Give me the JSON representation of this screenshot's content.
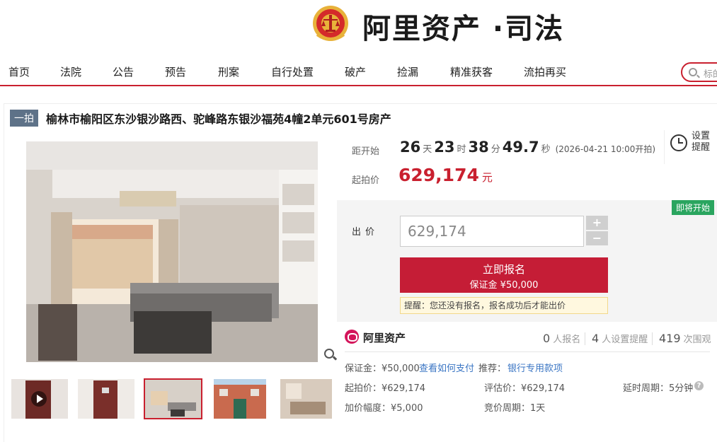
{
  "header": {
    "logo_text": "阿里资产 ·司法"
  },
  "nav": {
    "items": [
      "首页",
      "法院",
      "公告",
      "预告",
      "刑案",
      "自行处置",
      "破产",
      "捡漏",
      "精准获客",
      "流拍再买"
    ],
    "search_placeholder": "标的"
  },
  "auction": {
    "badge": "一拍",
    "title": "榆林市榆阳区东沙银沙路西、驼峰路东银沙福苑4幢2单元601号房产"
  },
  "countdown": {
    "label": "距开始",
    "days": "26",
    "days_unit": "天",
    "hours": "23",
    "hours_unit": "时",
    "minutes": "38",
    "minutes_unit": "分",
    "seconds": "49.7",
    "seconds_unit": "秒",
    "start_time": "(2026-04-21 10:00开拍)"
  },
  "start_price": {
    "label": "起拍价",
    "value": "629,174",
    "unit": "元"
  },
  "reminder": {
    "label": "设置提醒"
  },
  "bid": {
    "status_badge": "即将开始",
    "label": "出价",
    "amount": "629,174",
    "plus": "+",
    "minus": "−",
    "apply_label": "立即报名",
    "deposit_label": "保证金 ¥50,000",
    "tip": "提醒：您还没有报名，报名成功后才能出价"
  },
  "stats": {
    "brand": "阿里资产",
    "signups": "0",
    "signups_label": "人报名",
    "reminders": "4",
    "reminders_label": "人设置提醒",
    "views": "419",
    "views_label": "次围观"
  },
  "details": {
    "deposit": "保证金：¥50,000",
    "how_to_pay": "查看如何支付",
    "recommend": "推荐：",
    "bank_fund": "银行专用款项",
    "start_price": "起拍价：¥629,174",
    "appraisal": "评估价：¥629,174",
    "delay_period": "延时周期：5分钟",
    "increment": "加价幅度：¥5,000",
    "bid_period": "竞价周期：1天"
  },
  "icons": [
    "court-emblem-icon",
    "search-icon",
    "clock-icon",
    "zoom-icon",
    "play-icon",
    "question-icon",
    "ali-logo-icon"
  ],
  "colors": {
    "accent": "#c9202f",
    "status_green": "#2aa55f",
    "link": "#3b76c4"
  }
}
